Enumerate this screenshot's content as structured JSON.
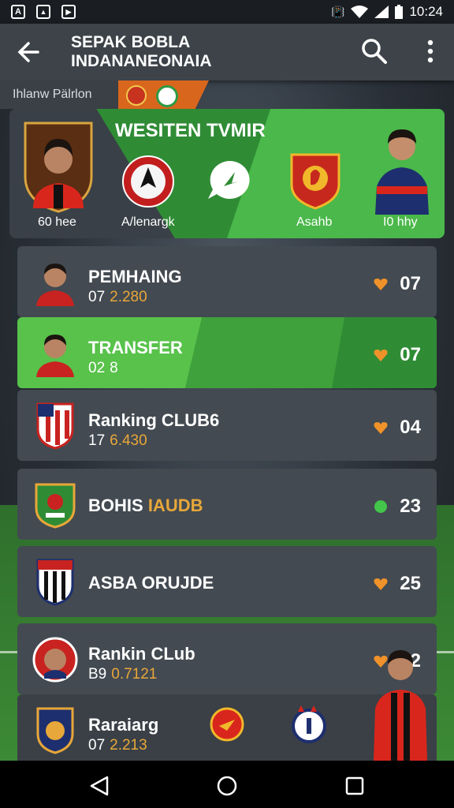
{
  "status_bar": {
    "time": "10:24",
    "left_icons": [
      "A",
      "image-icon",
      "video-icon"
    ],
    "right_icons": [
      "vibrate-icon",
      "wifi-icon",
      "signal-icon",
      "battery-icon"
    ]
  },
  "app_bar": {
    "title": "SEPAK BOBLA\nINDANANEONAIA",
    "back_icon": "arrow-left-icon",
    "search_icon": "search-icon",
    "more_icon": "more-vert-icon"
  },
  "sub_tab": {
    "label": "Ihlanw Pälrlon"
  },
  "hero": {
    "title": "WESITEN TVMIR",
    "labels": [
      "60 hee",
      "A/lenargk",
      "Asahb",
      "I0 hhy"
    ],
    "colors": {
      "green": "#4ab84a",
      "dark": "#394047"
    }
  },
  "rows": [
    {
      "name": "PEMHAING",
      "sub": "07",
      "value": "2.280",
      "count": "07",
      "heart_color": "#f0922a",
      "active": false
    },
    {
      "name": "TRANSFER",
      "sub": "02",
      "value": "8",
      "count": "07",
      "heart_color": "#f0922a",
      "active": true
    },
    {
      "name": "Ranking CLUB6",
      "sub": "17",
      "value": "6.430",
      "count": "04",
      "heart_color": "#f0922a",
      "active": false
    },
    {
      "name": "BOHIS",
      "name_accent": "IAUDB",
      "count": "23",
      "heart_color": "#43c44a",
      "active": false
    },
    {
      "name": "ASBA ORUJDE",
      "count": "25",
      "heart_color": "#f0922a",
      "active": false
    },
    {
      "name": "Rankin CLub",
      "sub": "B9",
      "value": "0.7121",
      "count": "2",
      "heart_color": "#f0922a",
      "active": false
    },
    {
      "name": "Raraiarg",
      "sub": "07",
      "value": "2.213",
      "active": false
    }
  ],
  "accent_colors": {
    "orange": "#e8a73a",
    "red": "#d9261c"
  }
}
